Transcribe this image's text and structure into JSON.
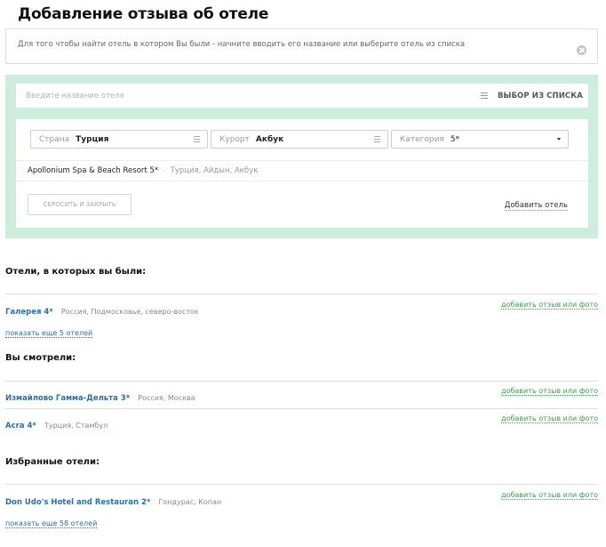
{
  "page": {
    "title": "Добавление отзыва об отеле",
    "hint": "Для того чтобы найти отель в котором Вы были - начните вводить его название или выберите отель из списка"
  },
  "search": {
    "placeholder": "Введите название отеля",
    "value": "",
    "list_button": "ВЫБОР ИЗ СПИСКА"
  },
  "filters": {
    "country_label": "Страна",
    "country_value": "Турция",
    "resort_label": "Курорт",
    "resort_value": "Акбук",
    "category_label": "Категория",
    "category_value": "5*"
  },
  "result": {
    "name": "Apollonium Spa & Beach Resort 5*",
    "separator": "·",
    "location": "Турция, Айдын, Акбук"
  },
  "actions": {
    "reset": "СБРОСИТЬ И ЗАКРЫТЬ",
    "add_hotel": "Добавить отель"
  },
  "visited": {
    "heading": "Отели, в которых вы были:",
    "hotels": [
      {
        "name": "Галерея 4*",
        "location": "Россия, Подмосковье, северо-восток",
        "action": "добавить отзыв или фото"
      }
    ],
    "more": "показать еще 5 отелей"
  },
  "viewed": {
    "heading": "Вы смотрели:",
    "hotels": [
      {
        "name": "Измайлово Гамма-Дельта 3*",
        "location": "Россия, Москва",
        "action": "добавить отзыв или фото"
      },
      {
        "name": "Acra 4*",
        "location": "Турция, Стамбул",
        "action": "добавить отзыв или фото"
      }
    ]
  },
  "favorites": {
    "heading": "Избранные отели:",
    "hotels": [
      {
        "name": "Don Udo's Hotel and Restauran 2*",
        "location": "Гондурас, Копан",
        "action": "добавить отзыв или фото"
      }
    ],
    "more": "показать еще 58 отелей"
  },
  "colors": {
    "panel_background": "#cdeedd",
    "link_blue": "#2a6fa8",
    "link_green": "#3a9f4e"
  },
  "icons": [
    "close-icon",
    "menu-icon",
    "caret-down-icon"
  ]
}
